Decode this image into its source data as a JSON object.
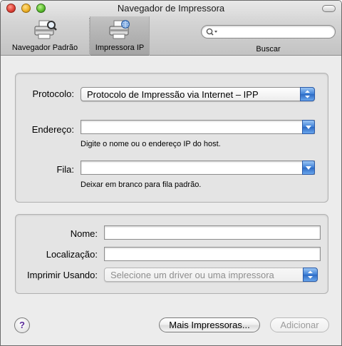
{
  "window": {
    "title": "Navegador de Impressora"
  },
  "toolbar": {
    "items": [
      {
        "label": "Navegador Padrão",
        "icon": "printer-browser-icon"
      },
      {
        "label": "Impressora IP",
        "icon": "ip-printer-icon",
        "selected": true
      }
    ],
    "search": {
      "placeholder": "",
      "value": "",
      "label": "Buscar"
    }
  },
  "connection": {
    "protocol_label": "Protocolo:",
    "protocol_value": "Protocolo de Impressão via Internet – IPP",
    "address_label": "Endereço:",
    "address_value": "",
    "address_hint": "Digite o nome ou o endereço IP do host.",
    "queue_label": "Fila:",
    "queue_value": "",
    "queue_hint": "Deixar em branco para fila padrão."
  },
  "printer": {
    "name_label": "Nome:",
    "name_value": "",
    "location_label": "Localização:",
    "location_value": "",
    "driver_label": "Imprimir Usando:",
    "driver_value": "Selecione um driver ou uma impressora"
  },
  "footer": {
    "help_label": "?",
    "more_printers_label": "Mais Impressoras...",
    "add_label": "Adicionar"
  },
  "colors": {
    "accent_blue": "#3d7fd6",
    "help_purple": "#5a2a9a"
  }
}
